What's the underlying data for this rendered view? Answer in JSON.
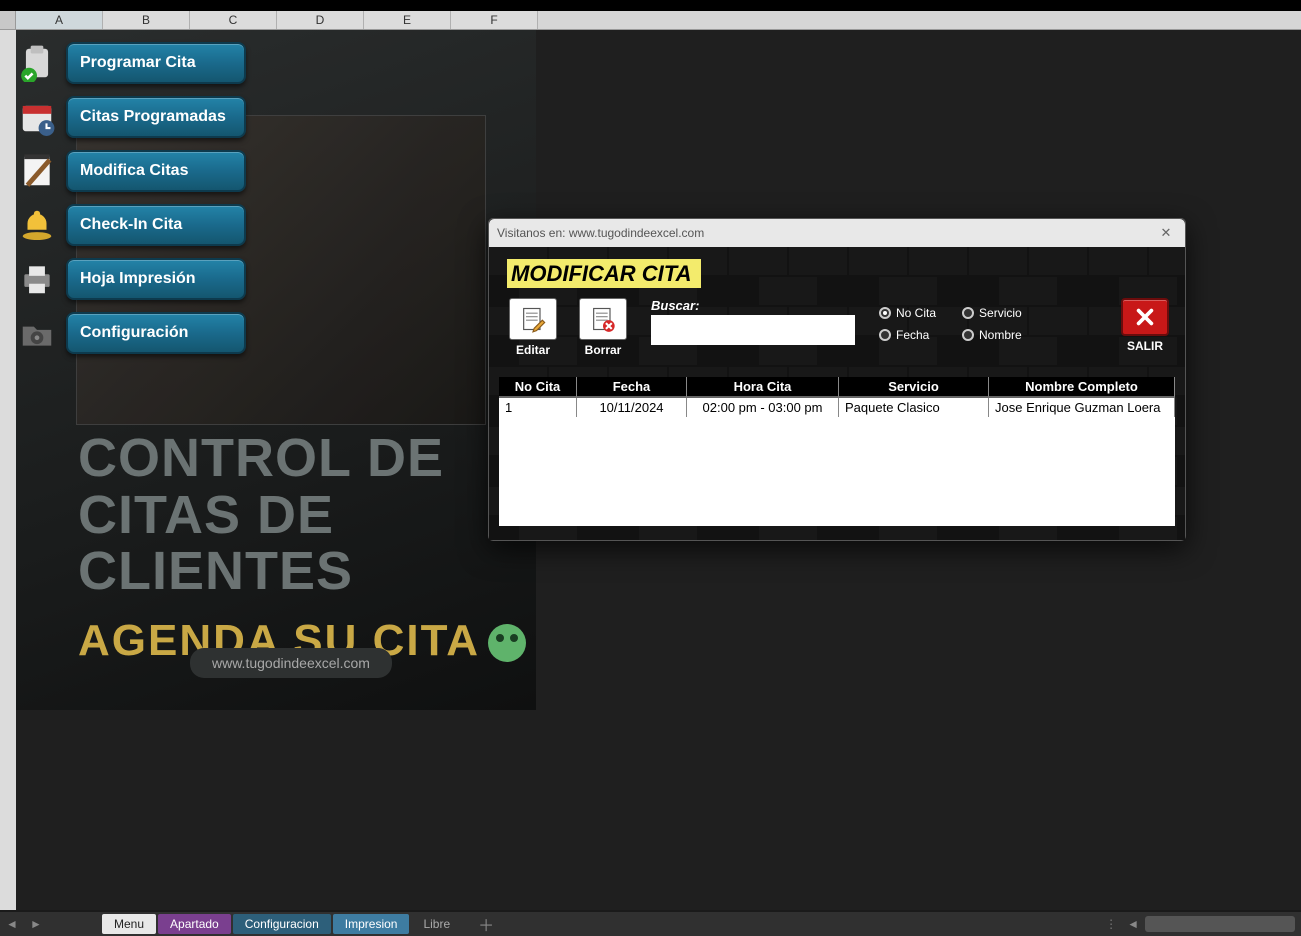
{
  "columns": [
    "A",
    "B",
    "C",
    "D",
    "E",
    "F"
  ],
  "menu": [
    {
      "label": "Programar Cita",
      "icon": "clipboard-check"
    },
    {
      "label": "Citas Programadas",
      "icon": "calendar"
    },
    {
      "label": "Modifica Citas",
      "icon": "notepad"
    },
    {
      "label": "Check-In Cita",
      "icon": "bell"
    },
    {
      "label": "Hoja Impresión",
      "icon": "printer"
    },
    {
      "label": "Configuración",
      "icon": "gear-folder"
    }
  ],
  "banner": {
    "line1": "CONTROL DE",
    "line2": "CITAS DE CLIENTES",
    "line3": "AGENDA SU CITA",
    "url": "www.tugodindeexcel.com"
  },
  "dialog": {
    "titlebar": "Visitanos en: www.tugodindeexcel.com",
    "heading": "MODIFICAR CITA",
    "actions": {
      "edit": "Editar",
      "delete": "Borrar"
    },
    "search": {
      "label": "Buscar:",
      "value": ""
    },
    "radios": {
      "r1": "No Cita",
      "r2": "Servicio",
      "r3": "Fecha",
      "r4": "Nombre",
      "selected": "r1"
    },
    "exit": "SALIR",
    "table": {
      "headers": [
        "No Cita",
        "Fecha",
        "Hora Cita",
        "Servicio",
        "Nombre Completo"
      ],
      "rows": [
        {
          "no": "1",
          "fecha": "10/11/2024",
          "hora": "02:00 pm - 03:00 pm",
          "servicio": "Paquete Clasico",
          "nombre": "Jose Enrique Guzman Loera"
        }
      ]
    }
  },
  "tabs": {
    "items": [
      {
        "label": "Menu",
        "style": "active"
      },
      {
        "label": "Apartado",
        "style": "purple"
      },
      {
        "label": "Configuracion",
        "style": "blue"
      },
      {
        "label": "Impresion",
        "style": "blue2"
      },
      {
        "label": "Libre",
        "style": "ghost"
      }
    ]
  }
}
